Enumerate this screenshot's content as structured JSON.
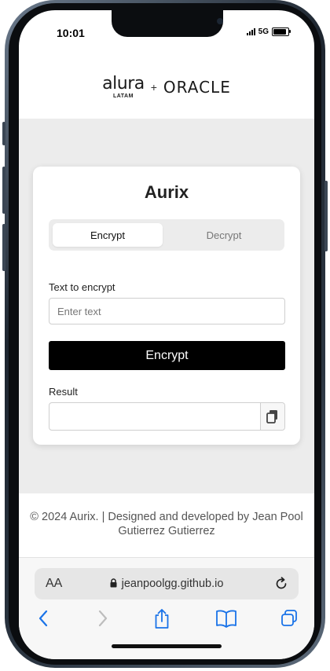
{
  "status_bar": {
    "time": "10:01",
    "network": "5G"
  },
  "header": {
    "brand_primary": "alura",
    "brand_primary_sub": "LATAM",
    "separator": "+",
    "brand_secondary": "ORACLE"
  },
  "card": {
    "title": "Aurix",
    "tabs": [
      {
        "label": "Encrypt",
        "active": true
      },
      {
        "label": "Decrypt",
        "active": false
      }
    ],
    "input_label": "Text to encrypt",
    "input_placeholder": "Enter text",
    "input_value": "",
    "action_button": "Encrypt",
    "result_label": "Result",
    "result_value": ""
  },
  "footer": {
    "text": "© 2024 Aurix. | Designed and developed by Jean Pool Gutierrez Gutierrez"
  },
  "browser": {
    "text_size_label": "AA",
    "url": "jeanpoolgg.github.io",
    "accent_color": "#1a73e8",
    "nav_icons": [
      "back-icon",
      "forward-icon",
      "share-icon",
      "bookmarks-icon",
      "tabs-icon"
    ]
  }
}
